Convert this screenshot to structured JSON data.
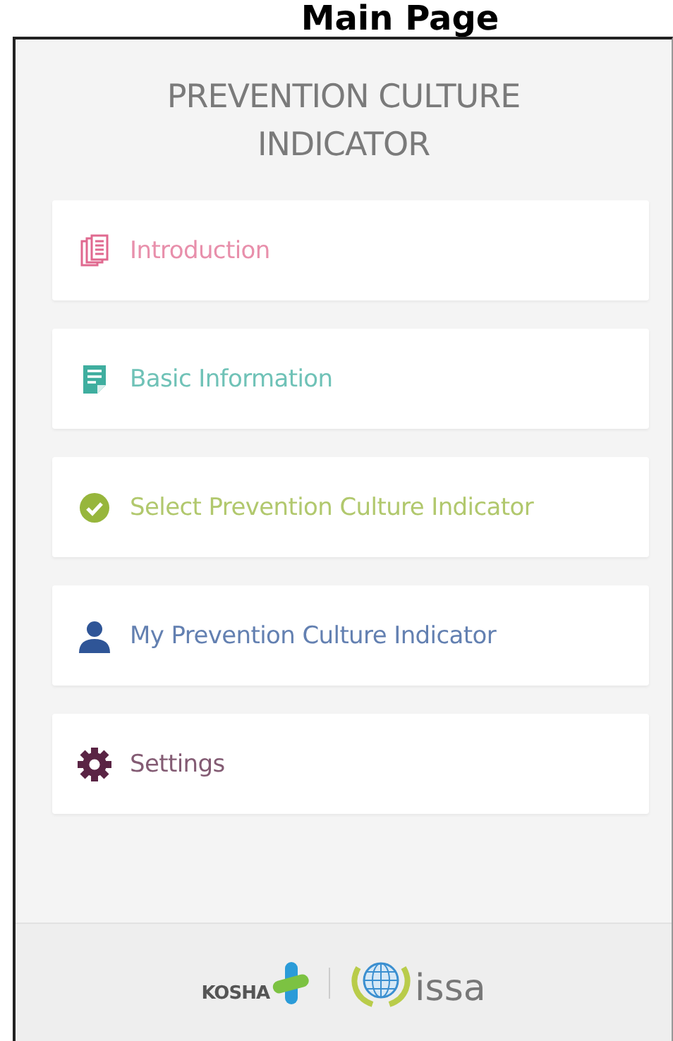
{
  "page_heading": "Main Page",
  "app_title": "PREVENTION CULTURE INDICATOR",
  "menu": [
    {
      "label": "Introduction",
      "kind": "documents",
      "color": "#e0698f"
    },
    {
      "label": "Basic Information",
      "kind": "form",
      "color": "#3fae9f"
    },
    {
      "label": "Select Prevention Culture Indicator",
      "kind": "check",
      "color": "#97b63c"
    },
    {
      "label": "My Prevention Culture Indicator",
      "kind": "person",
      "color": "#2f5597"
    },
    {
      "label": "Settings",
      "kind": "gear",
      "color": "#5a2444"
    }
  ],
  "footer": {
    "logos": [
      {
        "kind": "cross",
        "text": "KOSHA"
      },
      {
        "kind": "globe",
        "text": "issa"
      }
    ]
  }
}
